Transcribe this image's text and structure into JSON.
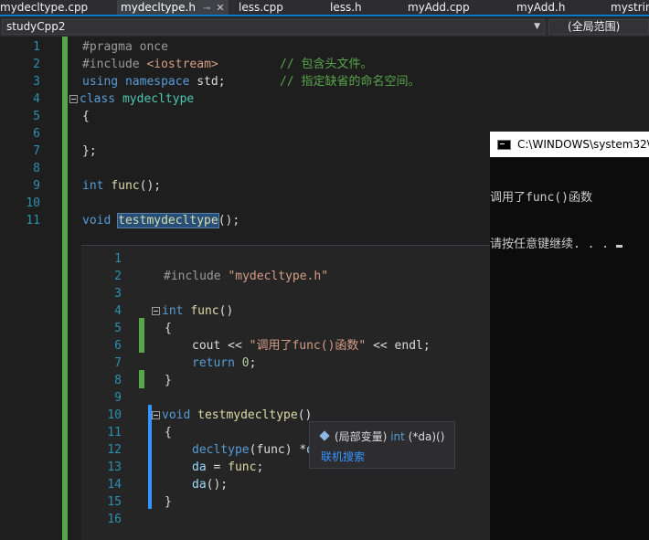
{
  "tabs": [
    {
      "label": "mydecltype.cpp",
      "active": false
    },
    {
      "label": "mydecltype.h",
      "active": true
    },
    {
      "label": "less.cpp",
      "active": false
    },
    {
      "label": "less.h",
      "active": false
    },
    {
      "label": "myAdd.cpp",
      "active": false
    },
    {
      "label": "myAdd.h",
      "active": false
    },
    {
      "label": "mystrin",
      "active": false
    }
  ],
  "navbar": {
    "project": "studyCpp2",
    "scope": "(全局范围)"
  },
  "editor": {
    "line_numbers": [
      "1",
      "2",
      "3",
      "4",
      "5",
      "6",
      "7",
      "8",
      "9",
      "10",
      "11"
    ],
    "lines": {
      "l1": "#pragma once",
      "l2a": "#include ",
      "l2b": "<iostream>",
      "l2c": "// 包含头文件。",
      "l3a": "using",
      "l3b": "namespace",
      "l3c": " std;",
      "l3d": "// 指定缺省的命名空间。",
      "l4a": "class",
      "l4b": "mydecltype",
      "l5": "{",
      "l7": "};",
      "l9a": "int",
      "l9b": "func",
      "l9c": "();",
      "l11a": "void",
      "l11b": "testmydecltype",
      "l11c": "();"
    }
  },
  "peek": {
    "line_numbers": [
      "1",
      "2",
      "3",
      "4",
      "5",
      "6",
      "7",
      "8",
      "9",
      "10",
      "11",
      "12",
      "13",
      "14",
      "15",
      "16"
    ],
    "lines": {
      "p2a": "#include ",
      "p2b": "\"mydecltype.h\"",
      "p4a": "int",
      "p4b": "func",
      "p4c": "()",
      "p5": "{",
      "p6a": "cout << ",
      "p6b": "\"调用了func()函数\"",
      "p6c": " << endl;",
      "p7a": "return",
      "p7b": "0",
      "p7c": ";",
      "p8": "}",
      "p10a": "void",
      "p10b": "testmydecltype",
      "p10c": "()",
      "p11": "{",
      "p12a": "decltype",
      "p12b": "(func) *",
      "p12c": "da",
      "p12d": ";",
      "p13a": "da",
      "p13b": " = ",
      "p13c": "func",
      "p13d": ";",
      "p14a": "da",
      "p14b": "();",
      "p15": "}"
    }
  },
  "console": {
    "title": "C:\\WINDOWS\\system32\\",
    "line1": "调用了func()函数",
    "line2": "请按任意键继续. . . "
  },
  "tooltip": {
    "prefix": "(局部变量)",
    "type_kw": "int",
    "signature": "(*da)()",
    "link": "联机搜索"
  }
}
